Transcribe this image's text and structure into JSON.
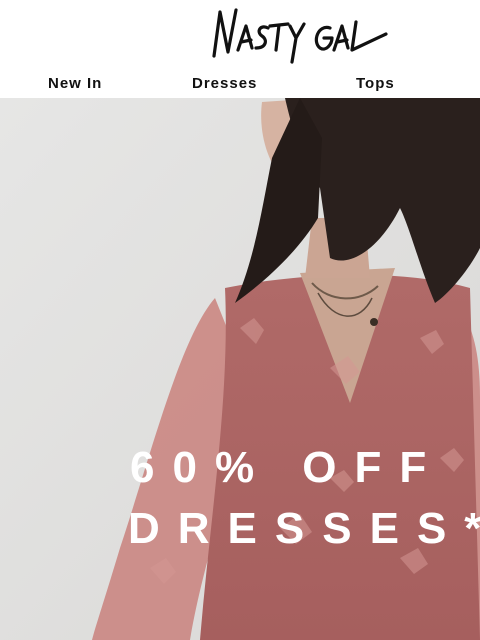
{
  "brand": {
    "logo_text": "NASTY GAL"
  },
  "nav": {
    "items": [
      {
        "label": "New In"
      },
      {
        "label": "Dresses"
      },
      {
        "label": "Tops"
      }
    ]
  },
  "hero": {
    "promo_line_1": "60% OFF",
    "promo_line_2": "DRESSES*"
  }
}
